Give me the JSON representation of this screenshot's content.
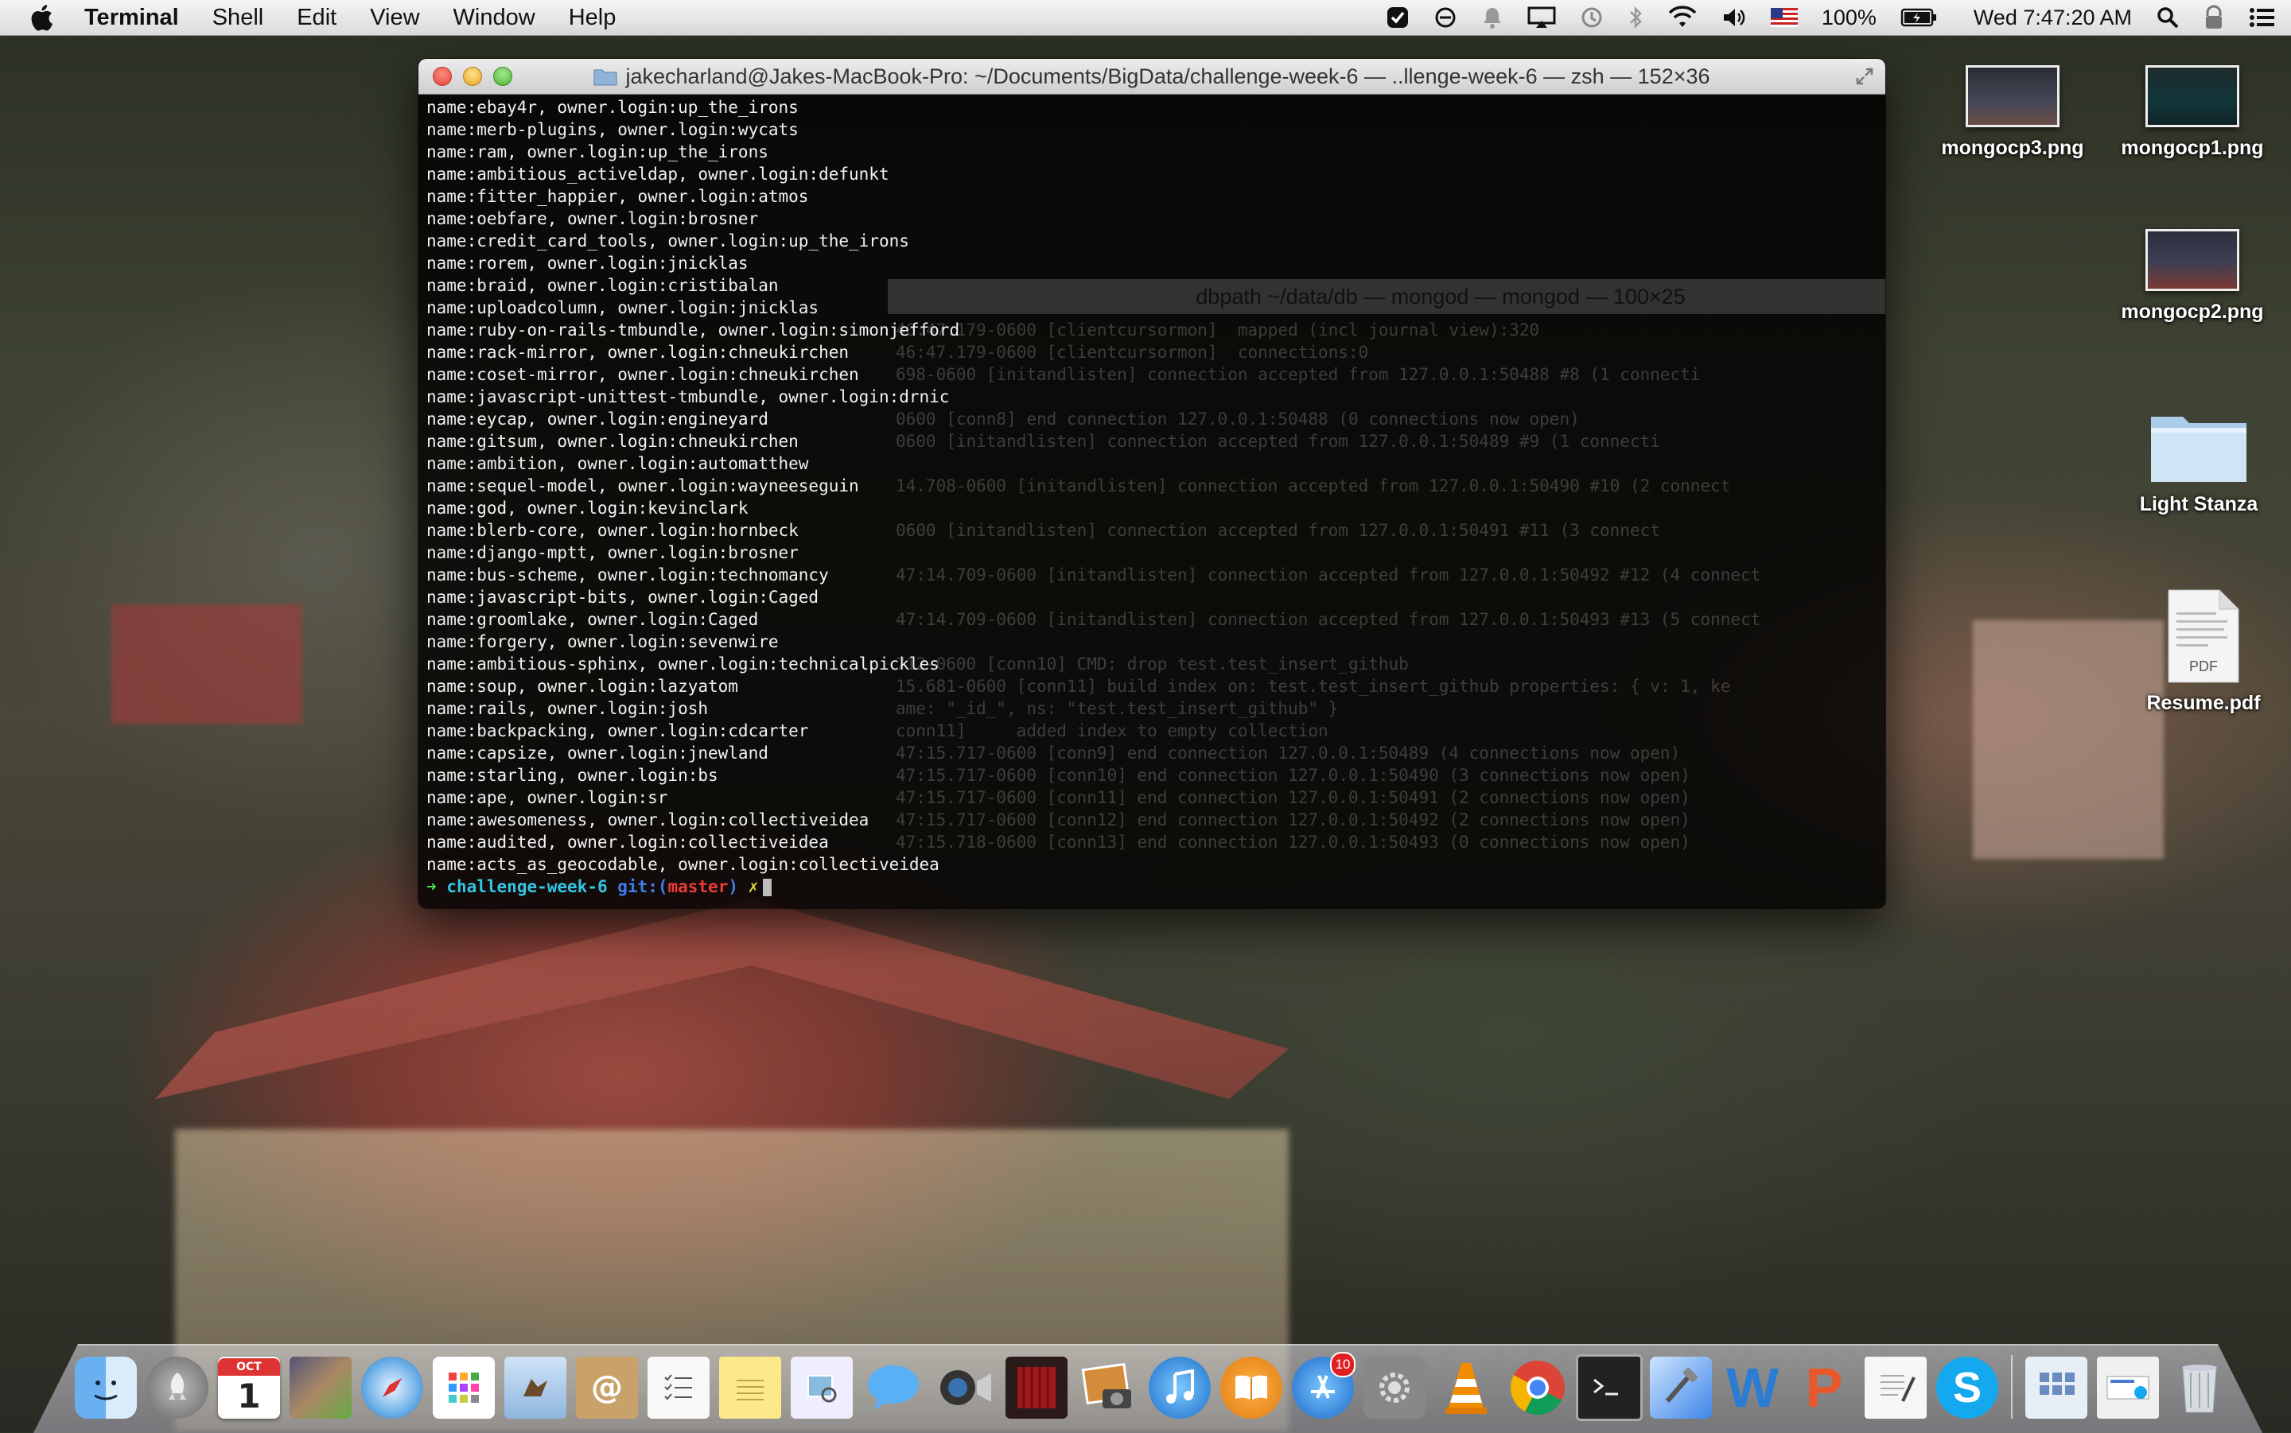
{
  "menubar": {
    "app": "Terminal",
    "menus": [
      "Shell",
      "Edit",
      "View",
      "Window",
      "Help"
    ],
    "battery": "100%",
    "clock": "Wed 7:47:20 AM"
  },
  "terminal": {
    "title": "jakecharland@Jakes-MacBook-Pro: ~/Documents/BigData/challenge-week-6 — ..llenge-week-6 — zsh — 152×36",
    "lines": [
      "name:ebay4r, owner.login:up_the_irons",
      "name:merb-plugins, owner.login:wycats",
      "name:ram, owner.login:up_the_irons",
      "name:ambitious_activeldap, owner.login:defunkt",
      "name:fitter_happier, owner.login:atmos",
      "name:oebfare, owner.login:brosner",
      "name:credit_card_tools, owner.login:up_the_irons",
      "name:rorem, owner.login:jnicklas",
      "name:braid, owner.login:cristibalan",
      "name:uploadcolumn, owner.login:jnicklas",
      "name:ruby-on-rails-tmbundle, owner.login:simonjefford",
      "name:rack-mirror, owner.login:chneukirchen",
      "name:coset-mirror, owner.login:chneukirchen",
      "name:javascript-unittest-tmbundle, owner.login:drnic",
      "name:eycap, owner.login:engineyard",
      "name:gitsum, owner.login:chneukirchen",
      "name:ambition, owner.login:automatthew",
      "name:sequel-model, owner.login:wayneeseguin",
      "name:god, owner.login:kevinclark",
      "name:blerb-core, owner.login:hornbeck",
      "name:django-mptt, owner.login:brosner",
      "name:bus-scheme, owner.login:technomancy",
      "name:javascript-bits, owner.login:Caged",
      "name:groomlake, owner.login:Caged",
      "name:forgery, owner.login:sevenwire",
      "name:ambitious-sphinx, owner.login:technicalpickles",
      "name:soup, owner.login:lazyatom",
      "name:rails, owner.login:josh",
      "name:backpacking, owner.login:cdcarter",
      "name:capsize, owner.login:jnewland",
      "name:starling, owner.login:bs",
      "name:ape, owner.login:sr",
      "name:awesomeness, owner.login:collectiveidea",
      "name:audited, owner.login:collectiveidea",
      "name:acts_as_geocodable, owner.login:collectiveidea"
    ],
    "prompt": {
      "arrow": "➜",
      "dir": "challenge-week-6",
      "git": "git:(",
      "branch": "master",
      "git_close": ")",
      "dirty": "✗"
    }
  },
  "background_window": {
    "title": "dbpath ~/data/db — mongod — mongod — 100×25",
    "lines": [
      "46:47.179-0600 [clientcursormon]  mapped (incl journal view):320",
      "46:47.179-0600 [clientcursormon]  connections:0",
      "698-0600 [initandlisten] connection accepted from 127.0.0.1:50488 #8 (1 connecti",
      "",
      "0600 [conn8] end connection 127.0.0.1:50488 (0 connections now open)",
      "0600 [initandlisten] connection accepted from 127.0.0.1:50489 #9 (1 connecti",
      "",
      "14.708-0600 [initandlisten] connection accepted from 127.0.0.1:50490 #10 (2 connect",
      "",
      "0600 [initandlisten] connection accepted from 127.0.0.1:50491 #11 (3 connect",
      "",
      "47:14.709-0600 [initandlisten] connection accepted from 127.0.0.1:50492 #12 (4 connect",
      "",
      "47:14.709-0600 [initandlisten] connection accepted from 127.0.0.1:50493 #13 (5 connect",
      "",
      "712-0600 [conn10] CMD: drop test.test_insert_github",
      "15.681-0600 [conn11] build index on: test.test_insert_github properties: { v: 1, ke",
      "ame: \"_id_\", ns: \"test.test_insert_github\" }",
      "conn11]     added index to empty collection",
      "47:15.717-0600 [conn9] end connection 127.0.0.1:50489 (4 connections now open)",
      "47:15.717-0600 [conn10] end connection 127.0.0.1:50490 (3 connections now open)",
      "47:15.717-0600 [conn11] end connection 127.0.0.1:50491 (2 connections now open)",
      "47:15.717-0600 [conn12] end connection 127.0.0.1:50492 (2 connections now open)",
      "47:15.718-0600 [conn13] end connection 127.0.0.1:50493 (0 connections now open)"
    ]
  },
  "desktop_icons": {
    "mongocp3": "mongocp3.png",
    "mongocp1": "mongocp1.png",
    "mongocp2": "mongocp2.png",
    "light_stanza": "Light Stanza",
    "resume": "Resume.pdf",
    "resume_badge": "PDF"
  },
  "dock": {
    "calendar_month": "OCT",
    "calendar_day": "1",
    "appstore_badge": "10"
  },
  "colors": {
    "prompt_arrow": "#4ee04e",
    "prompt_dir": "#34c6e6",
    "prompt_git": "#3f7df0",
    "prompt_branch": "#ef3a3a",
    "prompt_dirty": "#e6d23a"
  }
}
